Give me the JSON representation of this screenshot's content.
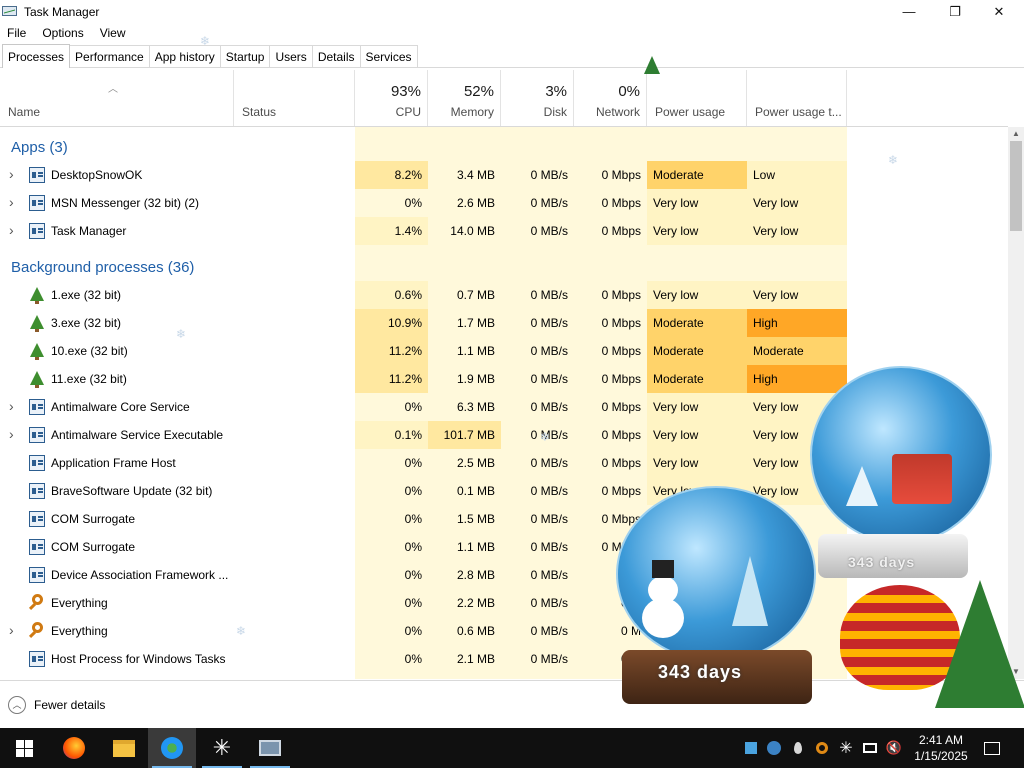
{
  "window": {
    "title": "Task Manager"
  },
  "window_controls": {
    "minimize": "—",
    "maximize": "❐",
    "close": "✕"
  },
  "menu": [
    "File",
    "Options",
    "View"
  ],
  "tabs": [
    "Processes",
    "Performance",
    "App history",
    "Startup",
    "Users",
    "Details",
    "Services"
  ],
  "active_tab": "Processes",
  "columns": {
    "name": "Name",
    "status": "Status",
    "cpu": {
      "pct": "93%",
      "label": "CPU"
    },
    "memory": {
      "pct": "52%",
      "label": "Memory"
    },
    "disk": {
      "pct": "3%",
      "label": "Disk"
    },
    "network": {
      "pct": "0%",
      "label": "Network"
    },
    "power": "Power usage",
    "power_trend": "Power usage t..."
  },
  "groups": {
    "apps": "Apps (3)",
    "background": "Background processes (36)"
  },
  "apps": [
    {
      "name": "DesktopSnowOK",
      "cpu": "8.2%",
      "memory": "3.4 MB",
      "disk": "0 MB/s",
      "network": "0 Mbps",
      "power": "Moderate",
      "power_trend": "Low",
      "expandable": true,
      "icon": "snowflake-icon"
    },
    {
      "name": "MSN Messenger (32 bit) (2)",
      "cpu": "0%",
      "memory": "2.6 MB",
      "disk": "0 MB/s",
      "network": "0 Mbps",
      "power": "Very low",
      "power_trend": "Very low",
      "expandable": true,
      "icon": "messenger-icon"
    },
    {
      "name": "Task Manager",
      "cpu": "1.4%",
      "memory": "14.0 MB",
      "disk": "0 MB/s",
      "network": "0 Mbps",
      "power": "Very low",
      "power_trend": "Very low",
      "expandable": true,
      "icon": "task-manager-icon"
    }
  ],
  "background": [
    {
      "name": "1.exe (32 bit)",
      "cpu": "0.6%",
      "memory": "0.7 MB",
      "disk": "0 MB/s",
      "network": "0 Mbps",
      "power": "Very low",
      "power_trend": "Very low",
      "expandable": false,
      "icon": "tree-icon"
    },
    {
      "name": "3.exe (32 bit)",
      "cpu": "10.9%",
      "memory": "1.7 MB",
      "disk": "0 MB/s",
      "network": "0 Mbps",
      "power": "Moderate",
      "power_trend": "High",
      "expandable": false,
      "icon": "tree-icon"
    },
    {
      "name": "10.exe (32 bit)",
      "cpu": "11.2%",
      "memory": "1.1 MB",
      "disk": "0 MB/s",
      "network": "0 Mbps",
      "power": "Moderate",
      "power_trend": "Moderate",
      "expandable": false,
      "icon": "tree-icon"
    },
    {
      "name": "11.exe (32 bit)",
      "cpu": "11.2%",
      "memory": "1.9 MB",
      "disk": "0 MB/s",
      "network": "0 Mbps",
      "power": "Moderate",
      "power_trend": "High",
      "expandable": false,
      "icon": "tree-icon"
    },
    {
      "name": "Antimalware Core Service",
      "cpu": "0%",
      "memory": "6.3 MB",
      "disk": "0 MB/s",
      "network": "0 Mbps",
      "power": "Very low",
      "power_trend": "Very low",
      "expandable": true,
      "icon": "service-icon"
    },
    {
      "name": "Antimalware Service Executable",
      "cpu": "0.1%",
      "memory": "101.7 MB",
      "disk": "0 MB/s",
      "network": "0 Mbps",
      "power": "Very low",
      "power_trend": "Very low",
      "expandable": true,
      "icon": "service-icon"
    },
    {
      "name": "Application Frame Host",
      "cpu": "0%",
      "memory": "2.5 MB",
      "disk": "0 MB/s",
      "network": "0 Mbps",
      "power": "Very low",
      "power_trend": "Very low",
      "expandable": false,
      "icon": "service-icon"
    },
    {
      "name": "BraveSoftware Update (32 bit)",
      "cpu": "0%",
      "memory": "0.1 MB",
      "disk": "0 MB/s",
      "network": "0 Mbps",
      "power": "Very low",
      "power_trend": "Very low",
      "expandable": false,
      "icon": "brave-update-icon"
    },
    {
      "name": "COM Surrogate",
      "cpu": "0%",
      "memory": "1.5 MB",
      "disk": "0 MB/s",
      "network": "0 Mbps",
      "power": "",
      "power_trend": "",
      "expandable": false,
      "icon": "service-icon"
    },
    {
      "name": "COM Surrogate",
      "cpu": "0%",
      "memory": "1.1 MB",
      "disk": "0 MB/s",
      "network": "0 Mbps",
      "power": "",
      "power_trend": "",
      "expandable": false,
      "icon": "service-icon"
    },
    {
      "name": "Device Association Framework ...",
      "cpu": "0%",
      "memory": "2.8 MB",
      "disk": "0 MB/s",
      "network": "0 M",
      "power": "",
      "power_trend": "",
      "expandable": false,
      "icon": "service-icon"
    },
    {
      "name": "Everything",
      "cpu": "0%",
      "memory": "2.2 MB",
      "disk": "0 MB/s",
      "network": "0 M",
      "power": "",
      "power_trend": "",
      "expandable": false,
      "icon": "search-icon"
    },
    {
      "name": "Everything",
      "cpu": "0%",
      "memory": "0.6 MB",
      "disk": "0 MB/s",
      "network": "0 M",
      "power": "",
      "power_trend": "",
      "expandable": true,
      "icon": "search-icon"
    },
    {
      "name": "Host Process for Windows Tasks",
      "cpu": "0%",
      "memory": "2.1 MB",
      "disk": "0 MB/s",
      "network": "0 M",
      "power": "",
      "power_trend": "",
      "expandable": false,
      "icon": "service-icon"
    }
  ],
  "footer": {
    "fewer_details": "Fewer details"
  },
  "globes": {
    "back_label": "343 days",
    "front_label": "343 days"
  },
  "taskbar": {
    "clock_time": "2:41 AM",
    "clock_date": "1/15/2025",
    "apps": [
      "start-icon",
      "firefox-icon",
      "file-explorer-icon",
      "messenger-icon",
      "desktopsnow-icon",
      "task-manager-icon"
    ]
  },
  "colors": {
    "cpu_heat_low": "#fff4c4",
    "cpu_heat_mid": "#ffe8a0",
    "memory_heat": "#fff4c4",
    "power_moderate": "#ffd36a",
    "power_high": "#ffa726",
    "power_verylow": "#fff4c4",
    "group_title": "#1f5fa8"
  }
}
